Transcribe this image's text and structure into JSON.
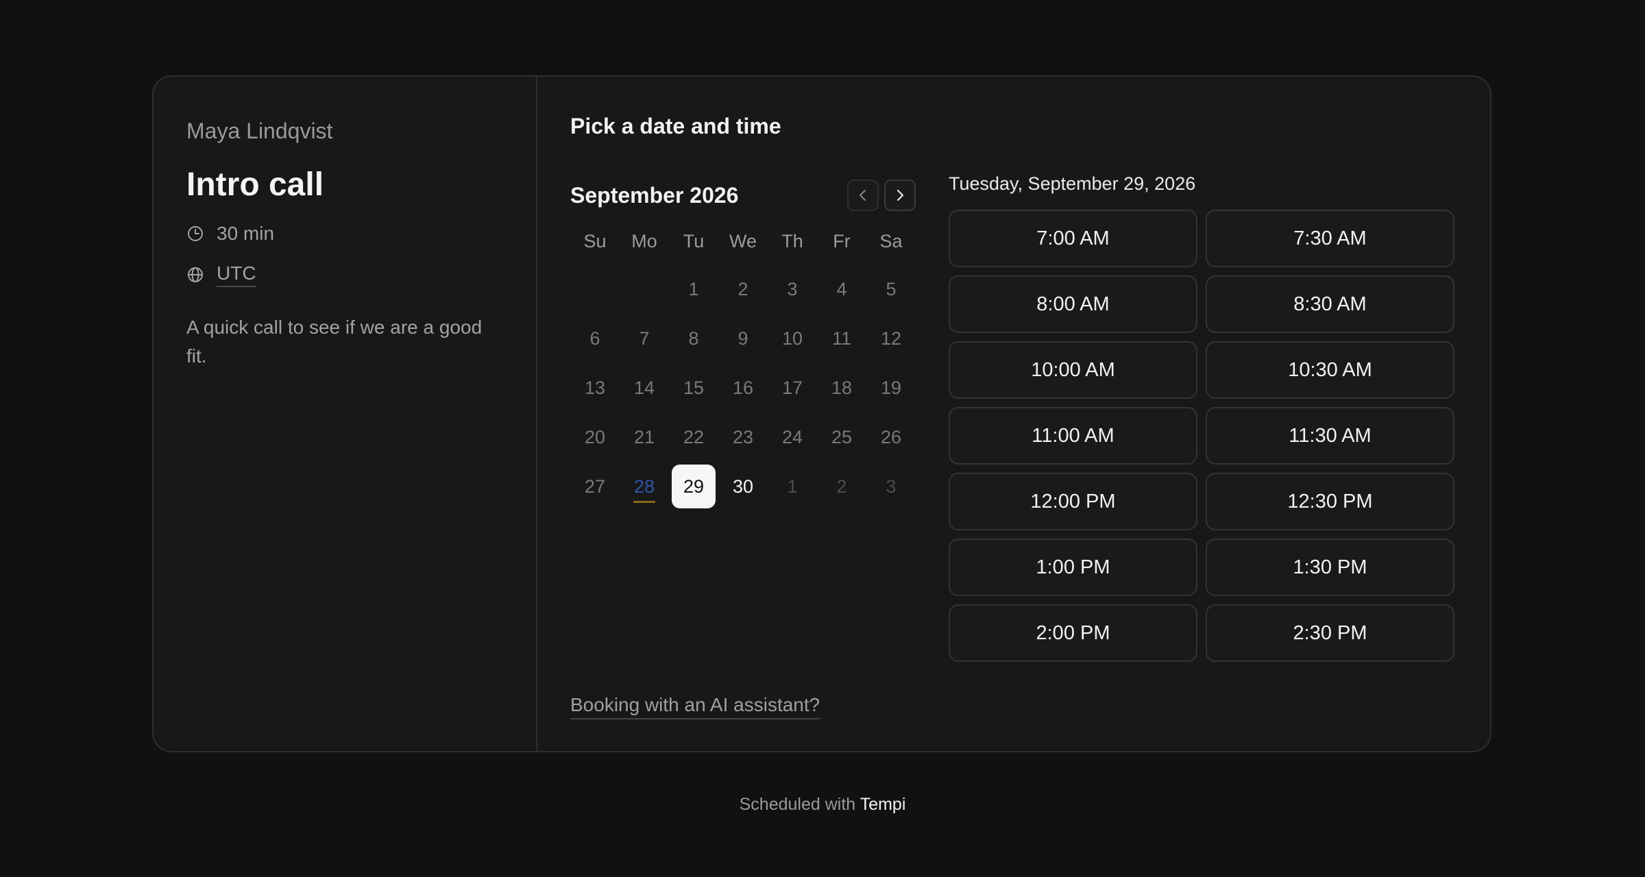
{
  "host_name": "Maya Lindqvist",
  "event": {
    "title": "Intro call",
    "duration": "30 min",
    "timezone": "UTC",
    "description": "A quick call to see if we are a good fit.",
    "duration_icon": "clock-icon",
    "timezone_icon": "globe-icon"
  },
  "booking": {
    "title": "Pick a date and time",
    "ai_link": "Booking with an AI assistant?"
  },
  "calendar": {
    "month_label": "September 2026",
    "prev_icon": "chevron-left-icon",
    "next_icon": "chevron-right-icon",
    "weekdays": [
      "Su",
      "Mo",
      "Tu",
      "We",
      "Th",
      "Fr",
      "Sa"
    ],
    "days": [
      {
        "label": "",
        "state": "empty"
      },
      {
        "label": "",
        "state": "empty"
      },
      {
        "label": "1",
        "state": "past"
      },
      {
        "label": "2",
        "state": "past"
      },
      {
        "label": "3",
        "state": "past"
      },
      {
        "label": "4",
        "state": "past"
      },
      {
        "label": "5",
        "state": "past"
      },
      {
        "label": "6",
        "state": "past"
      },
      {
        "label": "7",
        "state": "past"
      },
      {
        "label": "8",
        "state": "past"
      },
      {
        "label": "9",
        "state": "past"
      },
      {
        "label": "10",
        "state": "past"
      },
      {
        "label": "11",
        "state": "past"
      },
      {
        "label": "12",
        "state": "past"
      },
      {
        "label": "13",
        "state": "past"
      },
      {
        "label": "14",
        "state": "past"
      },
      {
        "label": "15",
        "state": "past"
      },
      {
        "label": "16",
        "state": "past"
      },
      {
        "label": "17",
        "state": "past"
      },
      {
        "label": "18",
        "state": "past"
      },
      {
        "label": "19",
        "state": "past"
      },
      {
        "label": "20",
        "state": "past"
      },
      {
        "label": "21",
        "state": "past"
      },
      {
        "label": "22",
        "state": "past"
      },
      {
        "label": "23",
        "state": "past"
      },
      {
        "label": "24",
        "state": "past"
      },
      {
        "label": "25",
        "state": "past"
      },
      {
        "label": "26",
        "state": "past"
      },
      {
        "label": "27",
        "state": "past"
      },
      {
        "label": "28",
        "state": "today"
      },
      {
        "label": "29",
        "state": "selected"
      },
      {
        "label": "30",
        "state": "available"
      },
      {
        "label": "1",
        "state": "muted"
      },
      {
        "label": "2",
        "state": "muted"
      },
      {
        "label": "3",
        "state": "muted"
      }
    ]
  },
  "slots": {
    "date_label": "Tuesday, September 29, 2026",
    "times": [
      "7:00 AM",
      "7:30 AM",
      "8:00 AM",
      "8:30 AM",
      "10:00 AM",
      "10:30 AM",
      "11:00 AM",
      "11:30 AM",
      "12:00 PM",
      "12:30 PM",
      "1:00 PM",
      "1:30 PM",
      "2:00 PM",
      "2:30 PM"
    ]
  },
  "footer": {
    "prefix": "Scheduled with",
    "brand": "Tempi"
  },
  "colors": {
    "background": "#111111",
    "card": "#181818",
    "today_accent": "#2f58a8",
    "today_underline": "#8a6a1c"
  }
}
